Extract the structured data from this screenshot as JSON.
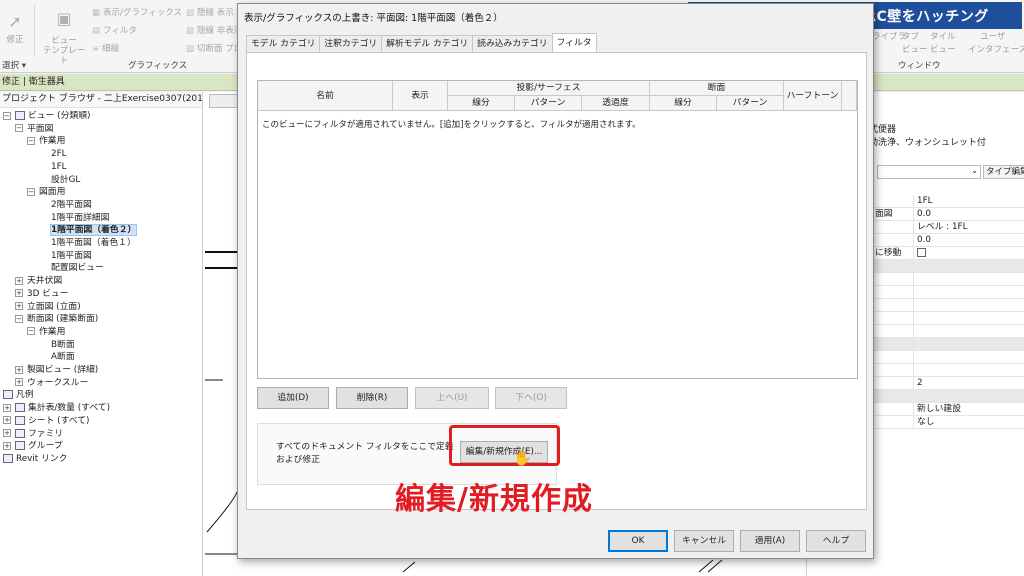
{
  "banner": "フィルタ機能を使ってRC壁をハッチング",
  "ribbon": {
    "left_items": [
      {
        "label": "修正",
        "x": 2
      },
      {
        "label": "ビュー\nテンプレート",
        "x": 46
      }
    ],
    "small_items": [
      "表示/グラフィックス",
      "フィルタ",
      "細線",
      "隠線 表示",
      "隠線 非表示",
      "切断面 プロ"
    ],
    "panel_select": "選択 ▾",
    "panel_graphics": "グラフィックス",
    "right_items": [
      "ライブラ",
      "タブ",
      "タイル",
      "ユーザ",
      "ビュー",
      "ビュー",
      "インタフェース"
    ],
    "panel_window": "ウィンドウ"
  },
  "context_bar": "修正 | 衛生器具",
  "browser": {
    "title": "プロジェクト ブラウザ - 二上Exercise0307(2015)",
    "rows": [
      {
        "text": "ビュー (分類順)",
        "indent": 0,
        "tog": "−",
        "icon": true
      },
      {
        "text": "平面図",
        "indent": 1,
        "tog": "−"
      },
      {
        "text": "作業用",
        "indent": 2,
        "tog": "−"
      },
      {
        "text": "2FL",
        "indent": 4
      },
      {
        "text": "1FL",
        "indent": 4
      },
      {
        "text": "設計GL",
        "indent": 4
      },
      {
        "text": "図面用",
        "indent": 2,
        "tog": "−"
      },
      {
        "text": "2階平面図",
        "indent": 4
      },
      {
        "text": "1階平面詳細図",
        "indent": 4
      },
      {
        "text": "1階平面図（着色２）",
        "indent": 4,
        "selected": true
      },
      {
        "text": "1階平面図（着色１）",
        "indent": 4
      },
      {
        "text": "1階平面図",
        "indent": 4
      },
      {
        "text": "配置図ビュー",
        "indent": 4
      },
      {
        "text": "天井伏図",
        "indent": 1,
        "tog": "+"
      },
      {
        "text": "3D ビュー",
        "indent": 1,
        "tog": "+"
      },
      {
        "text": "立面図 (立面)",
        "indent": 1,
        "tog": "+"
      },
      {
        "text": "断面図 (建築断面)",
        "indent": 1,
        "tog": "−"
      },
      {
        "text": "作業用",
        "indent": 2,
        "tog": "−"
      },
      {
        "text": "B断面",
        "indent": 4
      },
      {
        "text": "A断面",
        "indent": 4
      },
      {
        "text": "製図ビュー (詳細)",
        "indent": 1,
        "tog": "+"
      },
      {
        "text": "ウォークスルー",
        "indent": 1,
        "tog": "+"
      },
      {
        "text": "凡例",
        "indent": 0,
        "icon": true
      },
      {
        "text": "集計表/数量 (すべて)",
        "indent": 0,
        "tog": "+",
        "icon": true
      },
      {
        "text": "シート (すべて)",
        "indent": 0,
        "tog": "+",
        "icon": true
      },
      {
        "text": "ファミリ",
        "indent": 0,
        "tog": "+",
        "icon": true
      },
      {
        "text": "グループ",
        "indent": 0,
        "tog": "+",
        "icon": true
      },
      {
        "text": "Revit リンク",
        "indent": 0,
        "icon": true
      }
    ]
  },
  "properties": {
    "type_line1": "式便器",
    "type_line2": "動洗浄、ウォンシュレット付",
    "edit_type": "タイプ編集",
    "rows": [
      {
        "k": "",
        "v": "1FL"
      },
      {
        "k": "面図",
        "v": "0.0"
      },
      {
        "k": "",
        "v": "レベル : 1FL"
      },
      {
        "k": "",
        "v": "0.0"
      },
      {
        "k": "に移動",
        "v": "",
        "check": true
      },
      {
        "k": "",
        "v": "",
        "hdr": true
      },
      {
        "k": "",
        "v": ""
      },
      {
        "k": "",
        "v": ""
      },
      {
        "k": "",
        "v": ""
      },
      {
        "k": "",
        "v": ""
      },
      {
        "k": "",
        "v": ""
      },
      {
        "k": "",
        "v": "",
        "hdr": true
      },
      {
        "k": "",
        "v": ""
      },
      {
        "k": "",
        "v": ""
      },
      {
        "k": "",
        "v": "2"
      },
      {
        "k": "",
        "v": "",
        "hdr": true
      },
      {
        "k": "",
        "v": "新しい建設"
      },
      {
        "k": "",
        "v": "なし"
      }
    ]
  },
  "dialog": {
    "title": "表示/グラフィックスの上書き: 平面図: 1階平面図（着色２）",
    "tabs": [
      "モデル カテゴリ",
      "注釈カテゴリ",
      "解析モデル カテゴリ",
      "読み込みカテゴリ",
      "フィルタ"
    ],
    "active_tab": 4,
    "columns": {
      "name": "名前",
      "visible": "表示",
      "projection": "投影/サーフェス",
      "lines": "線分",
      "pattern": "パターン",
      "transparency": "透過度",
      "cut": "断面",
      "cut_lines": "線分",
      "cut_pattern": "パターン",
      "halftone": "ハーフトーン"
    },
    "empty_message": "このビューにフィルタが適用されていません。[追加]をクリックすると、フィルタが適用されます。",
    "buttons": {
      "add": "追加(D)",
      "remove": "削除(R)",
      "up": "上へ(U)",
      "down": "下へ(O)",
      "edit_new": "編集/新規作成(E)...",
      "ok": "OK",
      "cancel": "キャンセル",
      "apply": "適用(A)",
      "help": "ヘルプ"
    },
    "filter_note": "すべてのドキュメント フィルタをここで定義および修正"
  },
  "annotation": "編集/新規作成"
}
